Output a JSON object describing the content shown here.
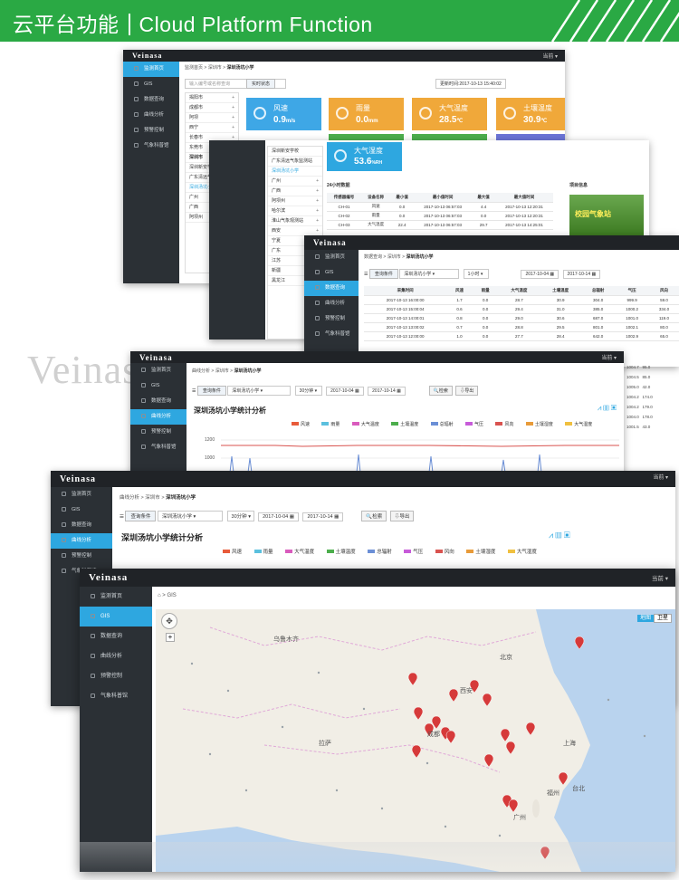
{
  "banner": {
    "title_cn": "云平台功能",
    "title_en": "Cloud Platform Function"
  },
  "watermark": "Veinasa",
  "brand": "Veinasa",
  "user_menu": "当前 ▾",
  "nav": [
    "监测首页",
    "GIS",
    "数据查询",
    "曲线分析",
    "预警控制",
    "气象科普馆"
  ],
  "colors": {
    "banner": "#2aa944",
    "active": "#2ea7e0",
    "sidebar": "#2b3035",
    "topbar": "#202327"
  },
  "w1": {
    "breadcrumb": [
      "监测首页",
      "深圳市",
      "深圳汤坑小学"
    ],
    "search_placeholder": "输入编号或名称查询",
    "tab": "实时状态",
    "update_time": "更新时间:2017-10-13 15:40:02",
    "cities": [
      "揭阳市",
      "成都市",
      "阿坝",
      "西宁",
      "长春市",
      "东莞市",
      "深圳市",
      "深圳新安学校",
      "广东清远气象监测站",
      "深圳汤坑小学",
      "广州",
      "广西",
      "阿坝州"
    ],
    "tiles": [
      {
        "label": "风速",
        "value": "0.9",
        "unit": "m/s",
        "color": "#3ea7e6"
      },
      {
        "label": "雨量",
        "value": "0.0",
        "unit": "mm",
        "color": "#f0a83a"
      },
      {
        "label": "大气温度",
        "value": "28.5",
        "unit": "℃",
        "color": "#f0a83a"
      },
      {
        "label": "土壤温度",
        "value": "30.9",
        "unit": "℃",
        "color": "#f0a83a"
      }
    ]
  },
  "w2": {
    "tile": {
      "label": "大气湿度",
      "value": "53.6",
      "unit": "%RH",
      "color": "#2ea7e0"
    },
    "section": "24小时数据",
    "project": "项目信息",
    "photo_caption": "校园气象站",
    "list": [
      "深圳新安学校",
      "广东清远气象监测站",
      "深圳汤坑小学",
      "广州",
      "广西",
      "阿坝州",
      "哈尔滨",
      "淮山气象观测站",
      "西安",
      "宁夏",
      "广东",
      "江苏",
      "新疆",
      "黑龙江"
    ],
    "columns": [
      "传感器编号",
      "设备名称",
      "最小值",
      "最小值时间",
      "最大值",
      "最大值时间"
    ],
    "rows": [
      [
        "CH-01",
        "风速",
        "0.0",
        "2017-10-13 06:57:03",
        "4.4",
        "2017-10-13 12:20:31"
      ],
      [
        "CH-02",
        "雨量",
        "0.0",
        "2017-10-13 06:57:03",
        "0.0",
        "2017-10-13 12:20:31"
      ],
      [
        "CH-03",
        "大气温度",
        "22.4",
        "2017-10-13 06:57:03",
        "29.7",
        "2017-10-13 14:25:01"
      ]
    ]
  },
  "w3": {
    "breadcrumb": [
      "数据查询",
      "深圳市",
      "深圳汤坑小学"
    ],
    "query_label": "查询条件",
    "station": "深圳汤坑小学",
    "interval": "1小时",
    "date_from": "2017-10-04",
    "date_to": "2017-10-14",
    "columns": [
      "采集时间",
      "风速",
      "雨量",
      "大气温度",
      "土壤温度",
      "总辐射",
      "气压",
      "风向"
    ],
    "rows": [
      [
        "2017-10-13 16:00:00",
        "1.7",
        "0.0",
        "28.7",
        "30.9",
        "304.0",
        "999.9",
        "59.0"
      ],
      [
        "2017-10-13 15:00:04",
        "0.6",
        "0.0",
        "29.4",
        "31.0",
        "385.0",
        "1000.2",
        "334.0"
      ],
      [
        "2017-10-13 14:00:01",
        "0.8",
        "0.0",
        "29.0",
        "30.6",
        "687.0",
        "1001.0",
        "119.0"
      ],
      [
        "2017-10-13 13:00:02",
        "0.7",
        "0.0",
        "28.8",
        "29.5",
        "801.0",
        "1002.1",
        "80.0"
      ],
      [
        "2017-10-13 12:00:00",
        "1.0",
        "0.0",
        "27.7",
        "28.4",
        "642.0",
        "1002.9",
        "65.0"
      ]
    ],
    "side_vals": [
      "1004.7",
      "1004.5",
      "1005.0",
      "1004.2",
      "1004.2",
      "1004.0",
      "1001.5"
    ],
    "side_vals2": [
      "95.0",
      "85.0",
      "42.0",
      "174.0",
      "179.0",
      "178.0",
      "43.0"
    ]
  },
  "w4": {
    "breadcrumb": [
      "曲线分析",
      "深圳市",
      "深圳汤坑小学"
    ],
    "query_label": "查询条件",
    "station": "深圳汤坑小学",
    "interval": "30分钟",
    "date_from": "2017-10-04",
    "date_to": "2017-10-14",
    "btn_search": "检索",
    "btn_export": "导出",
    "chart_title": "深圳汤坑小学统计分析",
    "legend": [
      "风速",
      "雨量",
      "大气温度",
      "土壤温度",
      "总辐射",
      "气压",
      "风向",
      "土壤湿度",
      "大气湿度"
    ],
    "y_ticks": [
      "1200",
      "1000"
    ]
  },
  "w5": {
    "breadcrumb": [
      "曲线分析",
      "深圳市",
      "深圳汤坑小学"
    ],
    "query_label": "查询条件",
    "station": "深圳汤坑小学",
    "interval": "30分钟",
    "date_from": "2017-10-04",
    "date_to": "2017-10-14",
    "btn_search": "检索",
    "btn_export": "导出",
    "chart_title": "深圳汤坑小学统计分析",
    "legend": [
      "风速",
      "雨量",
      "大气温度",
      "土壤温度",
      "总辐射",
      "气压",
      "风向",
      "土壤湿度",
      "大气湿度"
    ],
    "legend_colors": [
      "#e85b3a",
      "#5bc0de",
      "#d95bbd",
      "#4cae4c",
      "#6b8fd6",
      "#c75bd9",
      "#d9534f",
      "#e89b3a",
      "#f0c040"
    ]
  },
  "w6": {
    "breadcrumb": "GIS",
    "map_buttons": [
      "地图",
      "卫星"
    ],
    "city_labels": [
      "北京",
      "上海",
      "成都",
      "广州",
      "福州",
      "台北",
      "西安",
      "乌鲁木齐",
      "拉萨"
    ]
  }
}
